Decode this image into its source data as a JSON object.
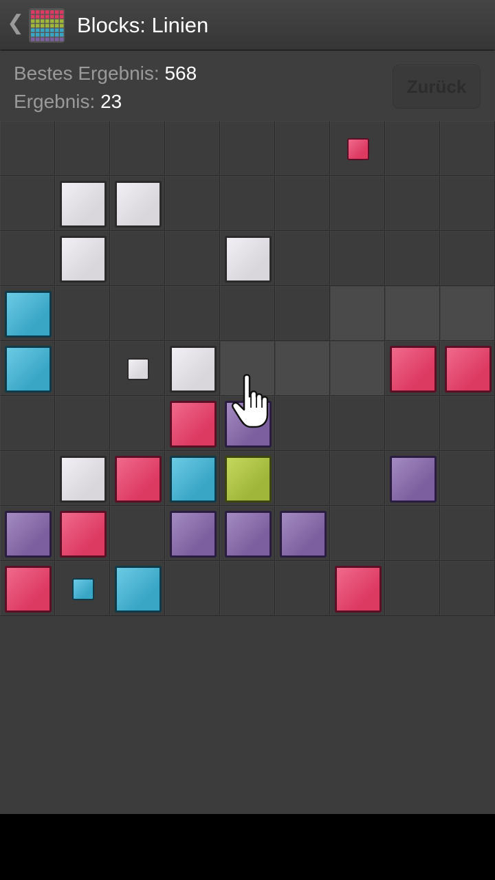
{
  "header": {
    "back_glyph": "❮",
    "title": "Blocks: Linien",
    "icon": "blocks-grid-icon"
  },
  "scores": {
    "best_label": "Bestes Ergebnis:",
    "best_value": "568",
    "current_label": "Ergebnis:",
    "current_value": "23"
  },
  "back_button": {
    "label": "Zurück"
  },
  "colors": {
    "white": "#d9d6dc",
    "pink": "#dd3a62",
    "blue": "#3aa6c6",
    "purple": "#7c5f9e",
    "green": "#9fb63a",
    "highlight_cell": "#4a4a4a"
  },
  "board": {
    "rows": 9,
    "cols": 9,
    "cells": [
      ".........",
      ".WW......",
      ".W..W....",
      "B........",
      "B..W...PP",
      "...PV....",
      ".WPBG..V.",
      "VP.VVV...",
      "P.B...P.."
    ],
    "preview_blocks": [
      {
        "row": 0,
        "col": 6,
        "color": "pink"
      },
      {
        "row": 4,
        "col": 2,
        "color": "white"
      },
      {
        "row": 8,
        "col": 1,
        "color": "blue"
      }
    ],
    "highlighted_cells": [
      {
        "row": 3,
        "col": 6
      },
      {
        "row": 3,
        "col": 7
      },
      {
        "row": 3,
        "col": 8
      },
      {
        "row": 4,
        "col": 4
      },
      {
        "row": 4,
        "col": 5
      },
      {
        "row": 4,
        "col": 6
      }
    ],
    "pointer": "hand-pointer-icon"
  }
}
